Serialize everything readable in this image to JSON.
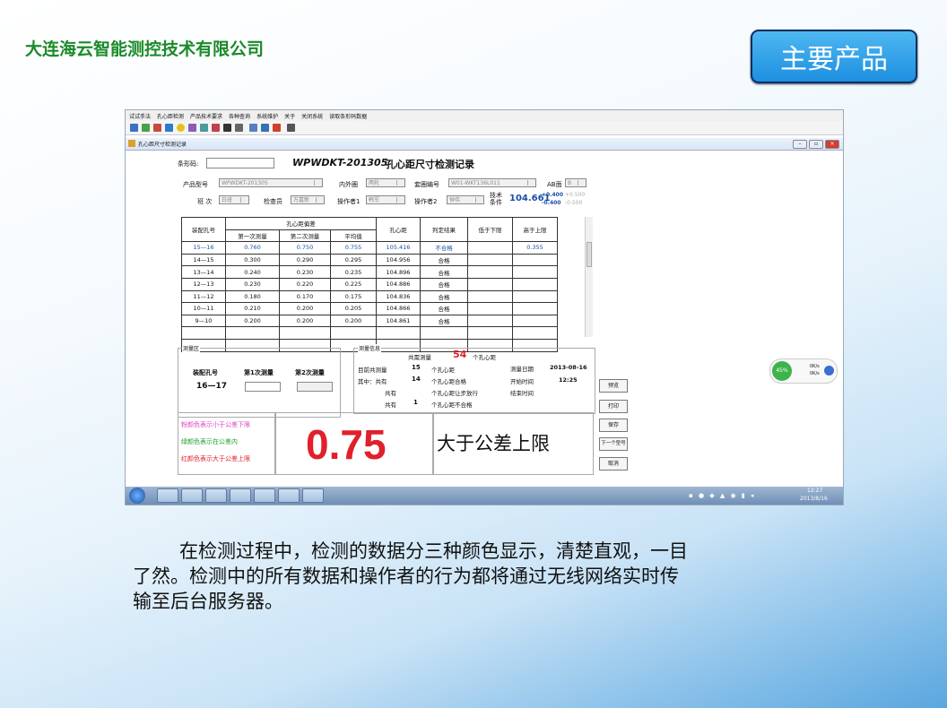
{
  "slide": {
    "company": "大连海云智能测控技术有限公司",
    "product_button": "主要产品",
    "caption_line1": "在检测过程中，检测的数据分三种颜色显示，清楚直观，一目",
    "caption_line2": "了然。检测中的所有数据和操作者的行为都将通过无线网络实时传",
    "caption_line3": "输至后台服务器。"
  },
  "app": {
    "menu": [
      "试试手法",
      "孔心距检测",
      "产品技术要求",
      "各种查询",
      "系统维护",
      "关于",
      "关闭系统",
      "读取条形码数据"
    ],
    "window_title": "孔心距尺寸检测记录",
    "barcode_label": "条形码:",
    "barcode_value": "",
    "doc_code": "WPWDKT-201305",
    "doc_title": "孔心距尺寸检测记录",
    "product_model_label": "产品型号",
    "product_model": "WPWDKT-201305",
    "inner_outer_label": "内外圈",
    "inner_outer": "两轮",
    "ring_no_label": "套圈编号",
    "ring_no": "W01-WKT136L011",
    "ab_label": "AB面",
    "ab_value": "B",
    "shift_label": "班  次",
    "shift": "白班",
    "inspector_label": "检查员",
    "inspector": "万嘉新",
    "operator1_label": "操作者1",
    "operator1": "韩军",
    "operator2_label": "操作者2",
    "operator2": "钟伟",
    "tech_label1": "技术",
    "tech_label2": "条件",
    "tech_value": "104.661",
    "tol_upper": "+0.400",
    "tol_lower": "-0.400",
    "tol_upper2": "+0.500",
    "tol_lower2": "-0.500",
    "table_headers": {
      "hole_no": "装配孔号",
      "deviation": "孔心距偏差",
      "first": "第一次测量",
      "second": "第二次测量",
      "avg": "平均值",
      "distance": "孔心距",
      "result": "判定结果",
      "below": "低于下限",
      "above": "高于上限"
    },
    "rows": [
      {
        "hole": "15—16",
        "first": "0.760",
        "second": "0.750",
        "avg": "0.755",
        "dist": "105.416",
        "result": "不合格",
        "below": "",
        "above": "0.355"
      },
      {
        "hole": "14—15",
        "first": "0.300",
        "second": "0.290",
        "avg": "0.295",
        "dist": "104.956",
        "result": "合格",
        "below": "",
        "above": ""
      },
      {
        "hole": "13—14",
        "first": "0.240",
        "second": "0.230",
        "avg": "0.235",
        "dist": "104.896",
        "result": "合格",
        "below": "",
        "above": ""
      },
      {
        "hole": "12—13",
        "first": "0.230",
        "second": "0.220",
        "avg": "0.225",
        "dist": "104.886",
        "result": "合格",
        "below": "",
        "above": ""
      },
      {
        "hole": "11—12",
        "first": "0.180",
        "second": "0.170",
        "avg": "0.175",
        "dist": "104.836",
        "result": "合格",
        "below": "",
        "above": ""
      },
      {
        "hole": "10—11",
        "first": "0.210",
        "second": "0.200",
        "avg": "0.205",
        "dist": "104.866",
        "result": "合格",
        "below": "",
        "above": ""
      },
      {
        "hole": "9—10",
        "first": "0.200",
        "second": "0.200",
        "avg": "0.200",
        "dist": "104.861",
        "result": "合格",
        "below": "",
        "above": ""
      }
    ],
    "measure_area_label": "测量区",
    "measure_hole_label": "装配孔号",
    "measure_hole": "16—17",
    "measure_first_label": "第1次测量",
    "measure_second_label": "第2次测量",
    "info_label": "测量信息",
    "total_prefix": "共需测量",
    "total_value": "54",
    "total_suffix": "个孔心距",
    "current_label": "目前共测量",
    "current_value": "15",
    "current_suffix": "个孔心距",
    "among_label": "其中：共有",
    "pass_value": "14",
    "pass_suffix": "个孔心距合格",
    "step_label": "共有",
    "step_suffix": "个孔心距让步放行",
    "fail_label": "共有",
    "fail_value": "1",
    "fail_suffix": "个孔心距不合格",
    "date_label": "测量日期",
    "date_value": "2013-08-16",
    "start_label": "开始时间",
    "start_value": "12:25",
    "end_label": "结束时间",
    "legend_pink": "粉颜色表示小于公差下限",
    "legend_green": "绿颜色表示在公差内",
    "legend_red": "红颜色表示大于公差上限",
    "big_value": "0.75",
    "big_status": "大于公差上限",
    "btn_preview": "预览",
    "btn_print": "打印",
    "btn_save": "保存",
    "btn_next": "下一个型号",
    "btn_cancel": "取消",
    "net_percent": "45%",
    "net_speed1": "0K/s",
    "net_speed2": "0K/s",
    "clock_time": "12:27",
    "clock_date": "2013/8/16"
  },
  "colors": {
    "company": "#1b8a2a",
    "accent": "#1d8fe0",
    "fail_red": "#e0202a",
    "value_blue": "#1a4fa8"
  }
}
